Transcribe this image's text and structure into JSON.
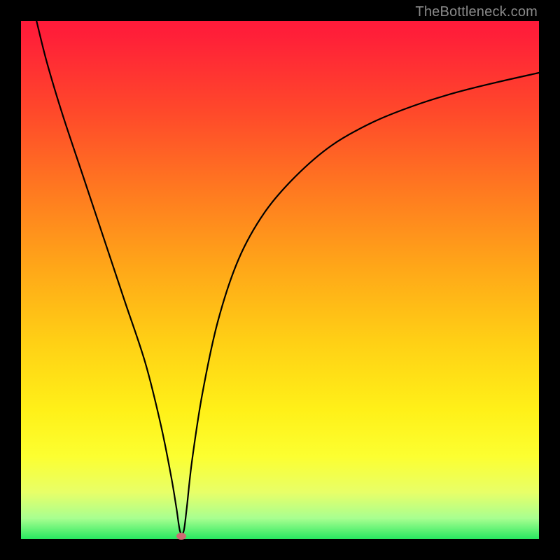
{
  "watermark": "TheBottleneck.com",
  "marker": {
    "color": "#cf6a72"
  },
  "chart_data": {
    "type": "line",
    "title": "",
    "xlabel": "",
    "ylabel": "",
    "xlim": [
      0,
      100
    ],
    "ylim": [
      0,
      100
    ],
    "series": [
      {
        "name": "curve",
        "x": [
          3,
          5,
          8,
          12,
          16,
          20,
          24,
          27,
          29,
          30,
          30.7,
          31.4,
          32,
          33,
          35,
          38,
          42,
          47,
          53,
          60,
          68,
          76,
          84,
          92,
          100
        ],
        "values": [
          100,
          92,
          82,
          70,
          58,
          46,
          34,
          22,
          12,
          6,
          1.5,
          1.5,
          6,
          15,
          28,
          42,
          54,
          63,
          70,
          76,
          80.5,
          83.7,
          86.2,
          88.2,
          90
        ]
      }
    ],
    "annotations": [
      {
        "type": "marker",
        "x": 31,
        "y": 0.6
      }
    ],
    "grid": false,
    "legend": false
  }
}
